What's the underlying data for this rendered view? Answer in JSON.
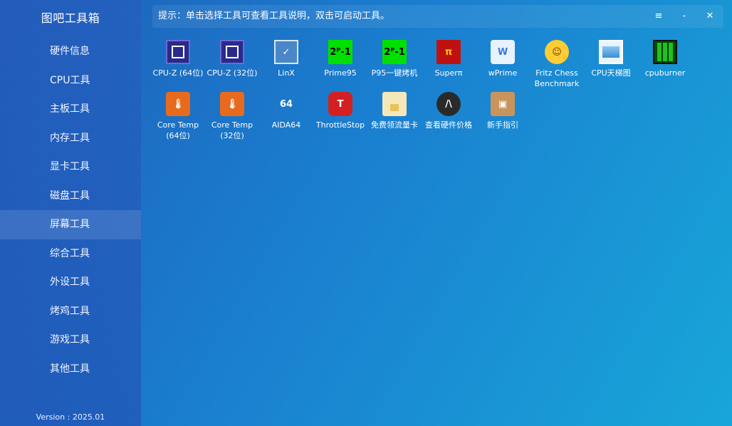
{
  "app": {
    "title": "图吧工具箱",
    "version": "Version : 2025.01"
  },
  "sidebar": {
    "items": [
      {
        "label": "硬件信息"
      },
      {
        "label": "CPU工具"
      },
      {
        "label": "主板工具"
      },
      {
        "label": "内存工具"
      },
      {
        "label": "显卡工具"
      },
      {
        "label": "磁盘工具"
      },
      {
        "label": "屏幕工具",
        "active": true
      },
      {
        "label": "综合工具"
      },
      {
        "label": "外设工具"
      },
      {
        "label": "烤鸡工具"
      },
      {
        "label": "游戏工具"
      },
      {
        "label": "其他工具"
      }
    ]
  },
  "hint": {
    "text": "提示：单击选择工具可查看工具说明，双击可启动工具。",
    "menu_icon": "≡",
    "min_icon": "-",
    "close_icon": "✕"
  },
  "tools": [
    {
      "label": "CPU-Z (64位)",
      "icon": "cpuz-icon",
      "glyph": ""
    },
    {
      "label": "CPU-Z (32位)",
      "icon": "cpuz-icon",
      "glyph": ""
    },
    {
      "label": "LinX",
      "icon": "linx-icon",
      "glyph": "✓"
    },
    {
      "label": "Prime95",
      "icon": "prime95-icon",
      "glyph": "2ᴾ-1"
    },
    {
      "label": "P95一键烤机",
      "icon": "prime95-icon",
      "glyph": "2ᴾ-1"
    },
    {
      "label": "Superπ",
      "icon": "superpi-icon",
      "glyph": "π"
    },
    {
      "label": "wPrime",
      "icon": "wprime-icon",
      "glyph": "W"
    },
    {
      "label": "Fritz Chess\nBenchmark",
      "icon": "fritz-icon",
      "glyph": "☺"
    },
    {
      "label": "CPU天梯图",
      "icon": "cpu-ladder-icon",
      "glyph": ""
    },
    {
      "label": "cpuburner",
      "icon": "cpuburner-icon",
      "glyph": ""
    },
    {
      "label": "Core Temp\n(64位)",
      "icon": "coretemp-icon",
      "glyph": "🌡"
    },
    {
      "label": "Core Temp\n(32位)",
      "icon": "coretemp-icon",
      "glyph": "🌡"
    },
    {
      "label": "AIDA64",
      "icon": "aida64-icon",
      "glyph": "64"
    },
    {
      "label": "ThrottleStop",
      "icon": "throttlestop-icon",
      "glyph": "T"
    },
    {
      "label": "免费领流量卡",
      "icon": "sim-card-icon",
      "glyph": ""
    },
    {
      "label": "查看硬件价格",
      "icon": "price-icon",
      "glyph": "/\\"
    },
    {
      "label": "新手指引",
      "icon": "guide-icon",
      "glyph": "▣"
    }
  ]
}
